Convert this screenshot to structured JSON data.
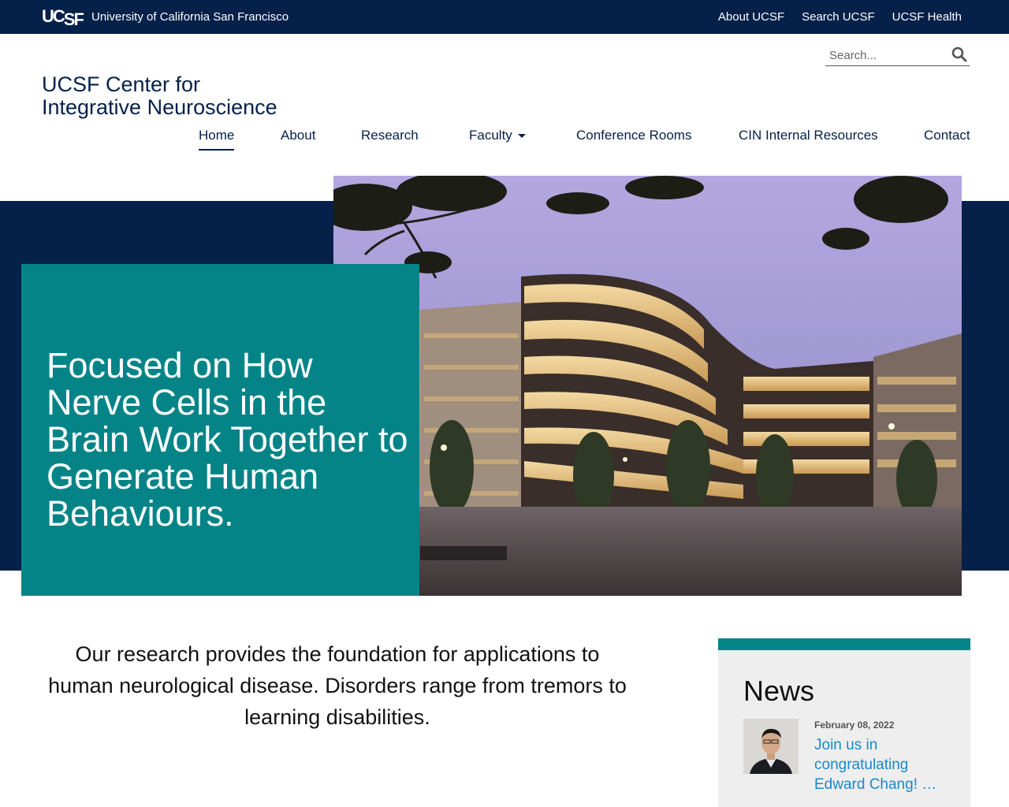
{
  "topbar": {
    "logo": "UCSF",
    "university": "University of California San Francisco",
    "links": [
      "About UCSF",
      "Search UCSF",
      "UCSF Health"
    ]
  },
  "header": {
    "title_line1": "UCSF Center for",
    "title_line2": "Integrative Neuroscience",
    "search_placeholder": "Search..."
  },
  "nav": {
    "items": [
      "Home",
      "About",
      "Research",
      "Faculty",
      "Conference Rooms",
      "CIN Internal Resources",
      "Contact"
    ],
    "active": "Home"
  },
  "hero": {
    "headline": "Focused on How Nerve Cells in the Brain Work Together to Generate Human Behaviours."
  },
  "intro": {
    "text": "Our research provides the foundation for applications to human neurological disease. Disorders range from tremors to learning disabilities."
  },
  "news": {
    "title": "News",
    "items": [
      {
        "date": "February 08, 2022",
        "headline": "Join us in congratulating Edward Chang! …"
      }
    ]
  },
  "colors": {
    "navy": "#052049",
    "teal": "#058488",
    "link": "#178acc"
  }
}
